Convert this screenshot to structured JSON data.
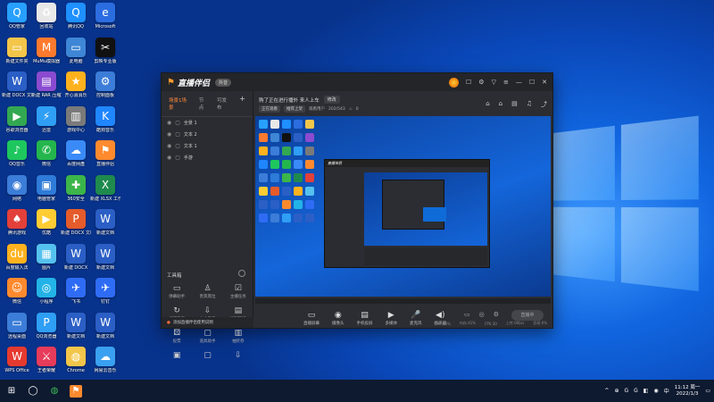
{
  "desktop": {
    "icons": [
      {
        "label": "QQ管家",
        "color": "#27a0ff",
        "glyph": "Q"
      },
      {
        "label": "回收站",
        "color": "#e8e8e8",
        "glyph": "♻"
      },
      {
        "label": "腾讯QQ",
        "color": "#1e90ff",
        "glyph": "Q"
      },
      {
        "label": "Microsoft",
        "color": "#2b6de0",
        "glyph": "e"
      },
      {
        "label": "新建文件夹",
        "color": "#f3c64a",
        "glyph": "▭"
      },
      {
        "label": "MuMu模拟器",
        "color": "#ff7a2e",
        "glyph": "M"
      },
      {
        "label": "此电脑",
        "color": "#3e86d6",
        "glyph": "▭"
      },
      {
        "label": "剪映专业版",
        "color": "#111111",
        "glyph": "✂"
      },
      {
        "label": "新建 DOCX 文档",
        "color": "#2b5fc6",
        "glyph": "W"
      },
      {
        "label": "新建 RAR 压缩文件",
        "color": "#8a4bd0",
        "glyph": "▤"
      },
      {
        "label": "开心消消乐",
        "color": "#ffb21e",
        "glyph": "★"
      },
      {
        "label": "控制面板",
        "color": "#3b7dd8",
        "glyph": "⚙"
      },
      {
        "label": "谷歌浏览器",
        "color": "#33a852",
        "glyph": "▶"
      },
      {
        "label": "迅雷",
        "color": "#2f9ef5",
        "glyph": "⚡"
      },
      {
        "label": "游戏中心",
        "color": "#7a7a7a",
        "glyph": "▥"
      },
      {
        "label": "酷狗音乐",
        "color": "#1f86ff",
        "glyph": "K"
      },
      {
        "label": "QQ音乐",
        "color": "#1ec75e",
        "glyph": "♪"
      },
      {
        "label": "微信",
        "color": "#24b64d",
        "glyph": "✆"
      },
      {
        "label": "百度网盘",
        "color": "#3a8bf7",
        "glyph": "☁"
      },
      {
        "label": "直播伴侣",
        "color": "#ff8a2e",
        "glyph": "⚑"
      },
      {
        "label": "网络",
        "color": "#3b7dd8",
        "glyph": "◉"
      },
      {
        "label": "电脑管家",
        "color": "#2e7bd9",
        "glyph": "▣"
      },
      {
        "label": "360安全",
        "color": "#3cb54a",
        "glyph": "✚"
      },
      {
        "label": "新建 XLSX 工作表",
        "color": "#1f8a4d",
        "glyph": "X"
      },
      {
        "label": "腾讯游戏",
        "color": "#e3403a",
        "glyph": "♠"
      },
      {
        "label": "优酷",
        "color": "#ffcc33",
        "glyph": "▶"
      },
      {
        "label": "新建 DOCX 文档",
        "color": "#e55b2b",
        "glyph": "P"
      },
      {
        "label": "新建文档",
        "color": "#2b5fc6",
        "glyph": "W"
      },
      {
        "label": "百度输入法",
        "color": "#ffb21e",
        "glyph": "du"
      },
      {
        "label": "图片",
        "color": "#55c1ee",
        "glyph": "▦"
      },
      {
        "label": "新建 DOCX",
        "color": "#2b5fc6",
        "glyph": "W"
      },
      {
        "label": "新建文档",
        "color": "#2b5fc6",
        "glyph": "W"
      },
      {
        "label": "微信",
        "color": "#ff8a2e",
        "glyph": "☺"
      },
      {
        "label": "小程序",
        "color": "#23b3e8",
        "glyph": "◎"
      },
      {
        "label": "飞书",
        "color": "#2f6cf5",
        "glyph": "✈"
      },
      {
        "label": "钉钉",
        "color": "#2f6cf5",
        "glyph": "✈"
      },
      {
        "label": "远程桌面",
        "color": "#3b7dd8",
        "glyph": "▭"
      },
      {
        "label": "QQ浏览器",
        "color": "#2f9ef5",
        "glyph": "P"
      },
      {
        "label": "新建文档",
        "color": "#2b5fc6",
        "glyph": "W"
      },
      {
        "label": "新建文档",
        "color": "#2b5fc6",
        "glyph": "W"
      },
      {
        "label": "WPS Office",
        "color": "#e53a2f",
        "glyph": "W"
      },
      {
        "label": "王者荣耀",
        "color": "#e63b5a",
        "glyph": "⚔"
      },
      {
        "label": "Chrome",
        "color": "#f3c64a",
        "glyph": "◍"
      },
      {
        "label": "网易云音乐",
        "color": "#3aa0f0",
        "glyph": "☁"
      }
    ]
  },
  "app": {
    "title": "直播伴侣",
    "version": "抖音",
    "titlebar_icons": [
      "avatar",
      "comment-icon",
      "settings-icon",
      "filter-icon",
      "menu-icon",
      "minimize-icon",
      "maximize-icon",
      "close-icon"
    ],
    "tabs": [
      "场景1场景",
      "节点",
      "可发布"
    ],
    "scenes": [
      "全景 1",
      "文本 2",
      "文本 1",
      "手游"
    ],
    "tools_header": "工具箱",
    "tools": [
      {
        "label": "弹幕助手",
        "glyph": "▭"
      },
      {
        "label": "贵宾席位",
        "glyph": "♙"
      },
      {
        "label": "主播任务",
        "glyph": "☑"
      },
      {
        "label": "视频连麦",
        "glyph": "↻"
      },
      {
        "label": "本人连麦",
        "glyph": "⇩"
      },
      {
        "label": "福利玩法",
        "glyph": "▤"
      },
      {
        "label": "投票",
        "glyph": "⚄"
      },
      {
        "label": "道具助手",
        "glyph": "▢"
      },
      {
        "label": "抽奖券",
        "glyph": "▥"
      },
      {
        "label": "",
        "glyph": "▣"
      },
      {
        "label": "",
        "glyph": "▢"
      },
      {
        "label": "",
        "glyph": "⇩"
      }
    ],
    "warning": "添加直播伴侣使用说明",
    "stream_title": "购了正在进行播外 来人上车",
    "edit_label": "修改",
    "sub_chips": [
      "正在观看",
      "推荐上架"
    ],
    "sub_meta": [
      "观看用户",
      "202/543",
      "0"
    ],
    "bottom_tools": [
      {
        "label": "直播屏幕",
        "glyph": "▭"
      },
      {
        "label": "摄像头",
        "glyph": "◉"
      },
      {
        "label": "手机投屏",
        "glyph": "▤"
      },
      {
        "label": "多媒体",
        "glyph": "▶"
      },
      {
        "label": "麦克风",
        "glyph": "🎤"
      },
      {
        "label": "扬声器",
        "glyph": "◀)"
      }
    ],
    "go_live_label": "直播中",
    "status_items": [
      "CPU:20%",
      "内存:41%",
      "FPS:30",
      "上传:0Kb/s",
      "丢帧:0%"
    ]
  },
  "taskbar": {
    "clock_time": "11:12 周一",
    "clock_date": "2022/1/3",
    "tray": [
      "^",
      "⊕",
      "G",
      "G",
      "◧",
      "◉",
      "中"
    ]
  }
}
